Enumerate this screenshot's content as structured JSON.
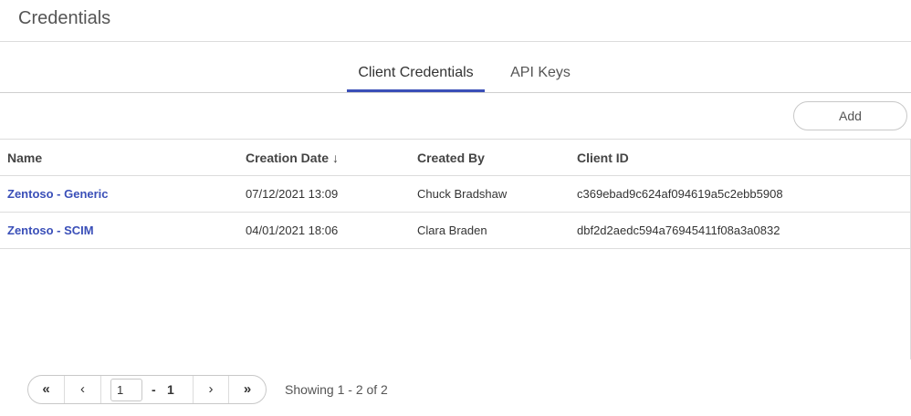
{
  "page": {
    "title": "Credentials"
  },
  "tabs": [
    {
      "label": "Client Credentials",
      "active": true
    },
    {
      "label": "API Keys",
      "active": false
    }
  ],
  "toolbar": {
    "add_label": "Add"
  },
  "table": {
    "columns": [
      "Name",
      "Creation Date",
      "Created By",
      "Client ID"
    ],
    "sort_icon": "sort-down-arrow",
    "rows": [
      {
        "name": "Zentoso - Generic",
        "date": "07/12/2021 13:09",
        "created_by": "Chuck Bradshaw",
        "client_id": "c369ebad9c624af094619a5c2ebb5908"
      },
      {
        "name": "Zentoso - SCIM",
        "date": "04/01/2021 18:06",
        "created_by": "Clara Braden",
        "client_id": "dbf2d2aedc594a76945411f08a3a0832"
      }
    ]
  },
  "pagination": {
    "first": "«",
    "prev": "‹",
    "current_page": "1",
    "dash": "-",
    "total_pages": "1",
    "next": "›",
    "last": "»",
    "showing": "Showing 1 - 2 of 2"
  },
  "colors": {
    "accent": "#3a4fb8",
    "border": "#dcdcdc"
  }
}
